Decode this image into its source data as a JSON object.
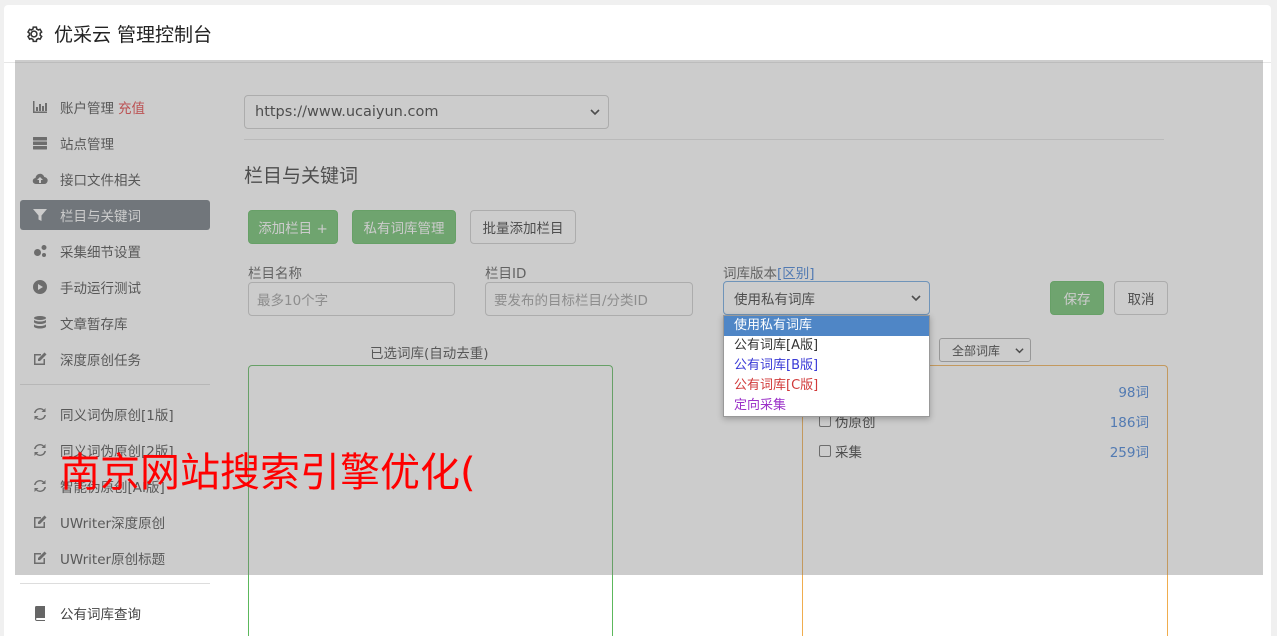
{
  "header": {
    "title": "优采云 管理控制台",
    "icon": "gear-icon"
  },
  "sidebar": {
    "group1": [
      {
        "label": "账户管理",
        "extra": "充值",
        "icon": "bar-chart-icon"
      },
      {
        "label": "站点管理",
        "icon": "server-icon"
      },
      {
        "label": "接口文件相关",
        "icon": "cloud-upload-icon"
      },
      {
        "label": "栏目与关键词",
        "icon": "filter-icon",
        "active": true
      },
      {
        "label": "采集细节设置",
        "icon": "cogs-icon"
      },
      {
        "label": "手动运行测试",
        "icon": "play-circle-icon"
      },
      {
        "label": "文章暂存库",
        "icon": "database-icon"
      },
      {
        "label": "深度原创任务",
        "icon": "edit-icon"
      }
    ],
    "group2": [
      {
        "label": "同义词伪原创[1版]",
        "icon": "refresh-icon"
      },
      {
        "label": "同义词伪原创[2版]",
        "icon": "refresh-icon"
      },
      {
        "label": "智能伪原创[AI版]",
        "icon": "refresh-icon"
      },
      {
        "label": "UWriter深度原创",
        "icon": "edit-icon"
      },
      {
        "label": "UWriter原创标题",
        "icon": "edit-icon"
      }
    ],
    "group3": [
      {
        "label": "公有词库查询",
        "icon": "book-icon"
      }
    ]
  },
  "main": {
    "site_select": "https://www.ucaiyun.com",
    "section_title": "栏目与关键词",
    "buttons": {
      "add_column": "添加栏目 +",
      "private_lib": "私有词库管理",
      "batch_add": "批量添加栏目"
    },
    "form": {
      "column_name_label": "栏目名称",
      "column_name_placeholder": "最多10个字",
      "column_id_label": "栏目ID",
      "column_id_placeholder": "要发布的目标栏目/分类ID",
      "lib_version_label": "词库版本",
      "lib_version_link": "[区别]",
      "lib_version_value": "使用私有词库",
      "save": "保存",
      "cancel": "取消"
    },
    "dropdown_options": [
      {
        "label": "使用私有词库",
        "color": "#ffffff",
        "selected": true
      },
      {
        "label": "公有词库[A版]",
        "color": "#333333"
      },
      {
        "label": "公有词库[B版]",
        "color": "#3a3ad6"
      },
      {
        "label": "公有词库[C版]",
        "color": "#d13a3a"
      },
      {
        "label": "定向采集",
        "color": "#9b30c8"
      }
    ],
    "selected_lib_title": "已选词库(自动去重)",
    "filter_select": "全部词库",
    "lib_list": [
      {
        "name": "",
        "count": "98词"
      },
      {
        "name": "伪原创",
        "count": "186词"
      },
      {
        "name": "采集",
        "count": "259词"
      }
    ]
  },
  "watermark": "南京网站搜索引擎优化(",
  "colors": {
    "green": "#6abf6a",
    "orange": "#f0ad4e",
    "active_nav": "#6c757d",
    "link": "#3a7bd5",
    "recharge": "#e4393c"
  }
}
